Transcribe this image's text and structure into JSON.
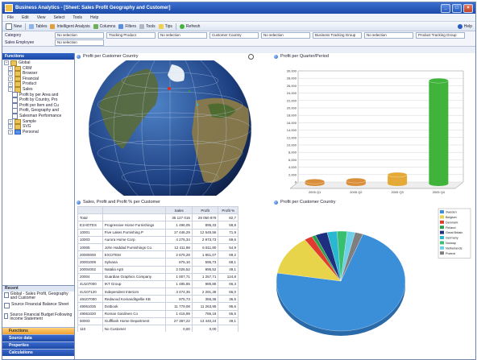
{
  "window": {
    "title": "Business Analytics - [Sheet: Sales Profit Geography and Customer]",
    "menus": [
      "File",
      "Edit",
      "View",
      "Select",
      "Tools",
      "Help"
    ]
  },
  "toolbar": {
    "items": [
      "New",
      "Tables",
      "Intelligent Analysis",
      "Columns",
      "Filters",
      "Tools",
      "Tips",
      "Refresh"
    ],
    "help": "Help"
  },
  "filters": [
    {
      "label": "Category",
      "values": [
        "No selection",
        "Tracking Product",
        "No selection",
        "Customer Country",
        "No selection",
        "Business Tracking Group",
        "No selection",
        "Product Tracking Group",
        "No selection"
      ]
    },
    {
      "label": "Sales Employee",
      "values": [
        "No selection"
      ]
    }
  ],
  "sidebar": {
    "header": "Functions",
    "tree": [
      {
        "level": 0,
        "icon": "folder",
        "label": "Global"
      },
      {
        "level": 1,
        "icon": "folder",
        "label": "CRM"
      },
      {
        "level": 1,
        "icon": "folder",
        "label": "Browser"
      },
      {
        "level": 1,
        "icon": "folder",
        "label": "Financial"
      },
      {
        "level": 1,
        "icon": "folder",
        "label": "Product"
      },
      {
        "level": 1,
        "icon": "folder",
        "label": "Sales"
      },
      {
        "level": 2,
        "icon": "doc",
        "label": "Profit by per Area and"
      },
      {
        "level": 2,
        "icon": "doc",
        "label": "Profit by Country, Pro"
      },
      {
        "level": 2,
        "icon": "doc",
        "label": "Profit per Item and Cu"
      },
      {
        "level": 2,
        "icon": "doc",
        "label": "Profit, Geography and"
      },
      {
        "level": 2,
        "icon": "doc",
        "label": "Salesman Performance"
      },
      {
        "level": 1,
        "icon": "folder",
        "label": "Sample"
      },
      {
        "level": 1,
        "icon": "folder",
        "label": "SVG"
      },
      {
        "level": 1,
        "icon": "blue",
        "label": "Personal"
      }
    ],
    "lower_header": "Recent",
    "recent": [
      "Global - Sales Profit, Geography and Customer",
      "Source Financial Balance Sheet",
      "Source Financial Budget Following Income Statement"
    ],
    "nav": [
      "Functions",
      "Source data",
      "Properties",
      "Calculations"
    ]
  },
  "globe_panel": {
    "title": "Profit per Customer Country"
  },
  "bar_panel": {
    "title": "Profit per Quarter/Period"
  },
  "table_panel": {
    "title": "Sales, Profit and Profit % per Customer",
    "headers": [
      "",
      "",
      "Sales",
      "Profit",
      "Profit %"
    ],
    "subheaders": [
      "Total",
      "",
      "35 127 015",
      "29 050 879",
      "82,7"
    ],
    "rows": [
      [
        "E1HOTES",
        "Progressive Home Furnishings",
        "1 496,05",
        "895,33",
        "59,8"
      ],
      [
        "10001",
        "Five Lakes Furnishing P",
        "17 446,29",
        "12 545,56",
        "71,9"
      ],
      [
        "10003",
        "Aurora Home Corp.",
        "4 275,34",
        "2 973,73",
        "69,6"
      ],
      [
        "10005",
        "John Haddad Furnishings Co.",
        "12 411,98",
        "6 811,80",
        "54,9"
      ],
      [
        "20000000",
        "EXCITEM",
        "2 675,28",
        "1 851,07",
        "69,2"
      ],
      [
        "20001009",
        "Sylvana",
        "875,10",
        "595,73",
        "68,1"
      ],
      [
        "20004002",
        "Natalia ApS",
        "2 026,52",
        "995,52",
        "49,1"
      ],
      [
        "20004",
        "Guardian Graphics Company",
        "1 007,71",
        "1 257,71",
        "124,8"
      ],
      [
        "4U107000",
        "IKT Group",
        "1 485,95",
        "985,86",
        "66,3"
      ],
      [
        "4U107120",
        "Independent Interiors",
        "3 474,35",
        "2 291,38",
        "66,0"
      ],
      [
        "46U07000",
        "Redwood Komanditgellie KB",
        "975,73",
        "356,36",
        "36,5"
      ],
      [
        "49061035",
        "Dotbook",
        "11 779,08",
        "11 263,95",
        "95,6"
      ],
      [
        "49061020",
        "Roman Gardinen Co",
        "1 415,99",
        "786,18",
        "55,5"
      ],
      [
        "50003",
        "Gulfflank Home Department",
        "27 387,22",
        "13 440,24",
        "49,1"
      ],
      [
        "110",
        "No Customer",
        "0,00",
        "0,00",
        ""
      ]
    ]
  },
  "pie_panel": {
    "title": "Profit per Customer Country"
  },
  "chart_data": [
    {
      "type": "bar",
      "title": "Profit per Quarter/Period",
      "categories": [
        "2005 Q1",
        "2005 Q2",
        "2005 Q3",
        "2005 Q4"
      ],
      "values": [
        600,
        850,
        2400,
        27800
      ],
      "ylim": [
        0,
        30000
      ],
      "yticks": [
        "0",
        "2,000",
        "4,000",
        "6,000",
        "8,000",
        "10,000",
        "12,000",
        "14,000",
        "16,000",
        "18,000",
        "20,000",
        "22,000",
        "24,000",
        "26,000",
        "28,000",
        "30,000"
      ],
      "colors": [
        "#d98e3a",
        "#d98e3a",
        "#e4a936",
        "#3fb33a"
      ],
      "grid": true
    },
    {
      "type": "pie",
      "title": "Profit per Customer Country",
      "slices": [
        {
          "name": "Sweden",
          "value": 72,
          "color": "#3a8fd8"
        },
        {
          "name": "Belgium",
          "value": 13,
          "color": "#e8d44a"
        },
        {
          "name": "Denmark",
          "value": 2,
          "color": "#e03b2c"
        },
        {
          "name": "Finland",
          "value": 1,
          "color": "#2ca04a"
        },
        {
          "name": "Great Britain",
          "value": 3,
          "color": "#1f2f7f"
        },
        {
          "name": "Germany",
          "value": 2.5,
          "color": "#2ab8d0"
        },
        {
          "name": "Norway",
          "value": 2.5,
          "color": "#38c070"
        },
        {
          "name": "Netherlands",
          "value": 2,
          "color": "#6bd0e8"
        },
        {
          "name": "Poland",
          "value": 2,
          "color": "#7f7f7f"
        }
      ],
      "legend_position": "right"
    }
  ],
  "colors": {
    "accent": "#1c4aa8",
    "nav_active": "#f0a030"
  }
}
